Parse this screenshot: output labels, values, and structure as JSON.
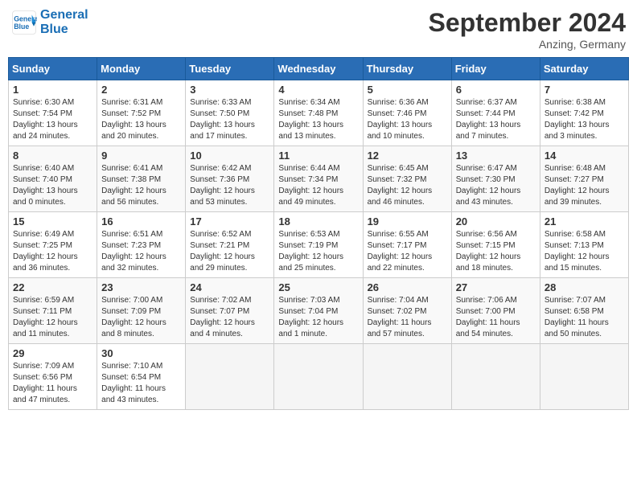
{
  "header": {
    "logo_line1": "General",
    "logo_line2": "Blue",
    "month": "September 2024",
    "location": "Anzing, Germany"
  },
  "days_of_week": [
    "Sunday",
    "Monday",
    "Tuesday",
    "Wednesday",
    "Thursday",
    "Friday",
    "Saturday"
  ],
  "weeks": [
    [
      {
        "day": "1",
        "sunrise": "6:30 AM",
        "sunset": "7:54 PM",
        "daylight": "13 hours and 24 minutes."
      },
      {
        "day": "2",
        "sunrise": "6:31 AM",
        "sunset": "7:52 PM",
        "daylight": "13 hours and 20 minutes."
      },
      {
        "day": "3",
        "sunrise": "6:33 AM",
        "sunset": "7:50 PM",
        "daylight": "13 hours and 17 minutes."
      },
      {
        "day": "4",
        "sunrise": "6:34 AM",
        "sunset": "7:48 PM",
        "daylight": "13 hours and 13 minutes."
      },
      {
        "day": "5",
        "sunrise": "6:36 AM",
        "sunset": "7:46 PM",
        "daylight": "13 hours and 10 minutes."
      },
      {
        "day": "6",
        "sunrise": "6:37 AM",
        "sunset": "7:44 PM",
        "daylight": "13 hours and 7 minutes."
      },
      {
        "day": "7",
        "sunrise": "6:38 AM",
        "sunset": "7:42 PM",
        "daylight": "13 hours and 3 minutes."
      }
    ],
    [
      {
        "day": "8",
        "sunrise": "6:40 AM",
        "sunset": "7:40 PM",
        "daylight": "13 hours and 0 minutes."
      },
      {
        "day": "9",
        "sunrise": "6:41 AM",
        "sunset": "7:38 PM",
        "daylight": "12 hours and 56 minutes."
      },
      {
        "day": "10",
        "sunrise": "6:42 AM",
        "sunset": "7:36 PM",
        "daylight": "12 hours and 53 minutes."
      },
      {
        "day": "11",
        "sunrise": "6:44 AM",
        "sunset": "7:34 PM",
        "daylight": "12 hours and 49 minutes."
      },
      {
        "day": "12",
        "sunrise": "6:45 AM",
        "sunset": "7:32 PM",
        "daylight": "12 hours and 46 minutes."
      },
      {
        "day": "13",
        "sunrise": "6:47 AM",
        "sunset": "7:30 PM",
        "daylight": "12 hours and 43 minutes."
      },
      {
        "day": "14",
        "sunrise": "6:48 AM",
        "sunset": "7:27 PM",
        "daylight": "12 hours and 39 minutes."
      }
    ],
    [
      {
        "day": "15",
        "sunrise": "6:49 AM",
        "sunset": "7:25 PM",
        "daylight": "12 hours and 36 minutes."
      },
      {
        "day": "16",
        "sunrise": "6:51 AM",
        "sunset": "7:23 PM",
        "daylight": "12 hours and 32 minutes."
      },
      {
        "day": "17",
        "sunrise": "6:52 AM",
        "sunset": "7:21 PM",
        "daylight": "12 hours and 29 minutes."
      },
      {
        "day": "18",
        "sunrise": "6:53 AM",
        "sunset": "7:19 PM",
        "daylight": "12 hours and 25 minutes."
      },
      {
        "day": "19",
        "sunrise": "6:55 AM",
        "sunset": "7:17 PM",
        "daylight": "12 hours and 22 minutes."
      },
      {
        "day": "20",
        "sunrise": "6:56 AM",
        "sunset": "7:15 PM",
        "daylight": "12 hours and 18 minutes."
      },
      {
        "day": "21",
        "sunrise": "6:58 AM",
        "sunset": "7:13 PM",
        "daylight": "12 hours and 15 minutes."
      }
    ],
    [
      {
        "day": "22",
        "sunrise": "6:59 AM",
        "sunset": "7:11 PM",
        "daylight": "12 hours and 11 minutes."
      },
      {
        "day": "23",
        "sunrise": "7:00 AM",
        "sunset": "7:09 PM",
        "daylight": "12 hours and 8 minutes."
      },
      {
        "day": "24",
        "sunrise": "7:02 AM",
        "sunset": "7:07 PM",
        "daylight": "12 hours and 4 minutes."
      },
      {
        "day": "25",
        "sunrise": "7:03 AM",
        "sunset": "7:04 PM",
        "daylight": "12 hours and 1 minute."
      },
      {
        "day": "26",
        "sunrise": "7:04 AM",
        "sunset": "7:02 PM",
        "daylight": "11 hours and 57 minutes."
      },
      {
        "day": "27",
        "sunrise": "7:06 AM",
        "sunset": "7:00 PM",
        "daylight": "11 hours and 54 minutes."
      },
      {
        "day": "28",
        "sunrise": "7:07 AM",
        "sunset": "6:58 PM",
        "daylight": "11 hours and 50 minutes."
      }
    ],
    [
      {
        "day": "29",
        "sunrise": "7:09 AM",
        "sunset": "6:56 PM",
        "daylight": "11 hours and 47 minutes."
      },
      {
        "day": "30",
        "sunrise": "7:10 AM",
        "sunset": "6:54 PM",
        "daylight": "11 hours and 43 minutes."
      },
      null,
      null,
      null,
      null,
      null
    ]
  ],
  "labels": {
    "sunrise": "Sunrise:",
    "sunset": "Sunset:",
    "daylight": "Daylight:"
  }
}
